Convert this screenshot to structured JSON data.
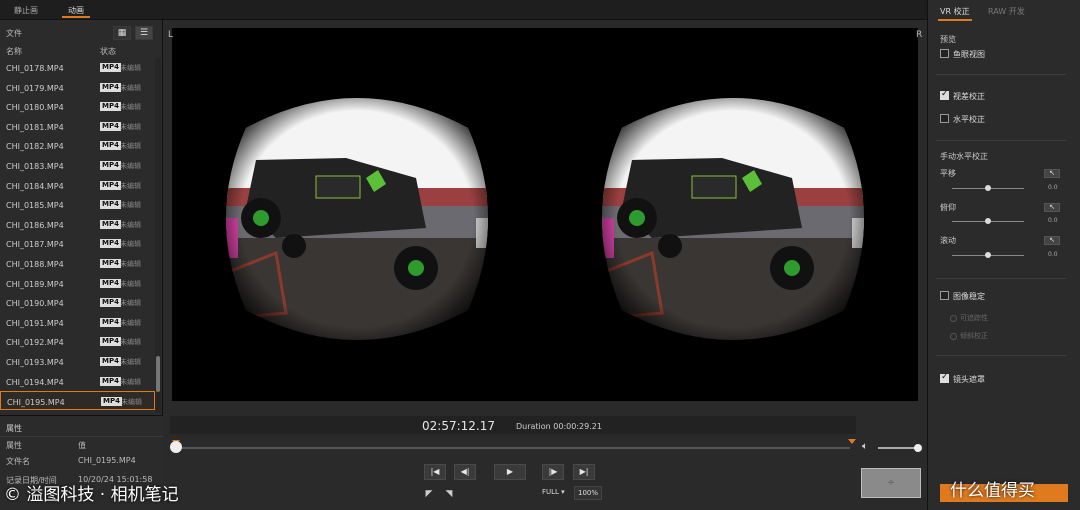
{
  "top_tabs": [
    "静止画",
    "动画"
  ],
  "left": {
    "files_label": "文件",
    "columns": {
      "name": "名称",
      "status": "状态"
    },
    "files": [
      {
        "name": "CHI_0178.MP4",
        "badge": "MP4",
        "status": "未编辑"
      },
      {
        "name": "CHI_0179.MP4",
        "badge": "MP4",
        "status": "未编辑"
      },
      {
        "name": "CHI_0180.MP4",
        "badge": "MP4",
        "status": "未编辑"
      },
      {
        "name": "CHI_0181.MP4",
        "badge": "MP4",
        "status": "未编辑"
      },
      {
        "name": "CHI_0182.MP4",
        "badge": "MP4",
        "status": "未编辑"
      },
      {
        "name": "CHI_0183.MP4",
        "badge": "MP4",
        "status": "未编辑"
      },
      {
        "name": "CHI_0184.MP4",
        "badge": "MP4",
        "status": "未编辑"
      },
      {
        "name": "CHI_0185.MP4",
        "badge": "MP4",
        "status": "未编辑"
      },
      {
        "name": "CHI_0186.MP4",
        "badge": "MP4",
        "status": "未编辑"
      },
      {
        "name": "CHI_0187.MP4",
        "badge": "MP4",
        "status": "未编辑"
      },
      {
        "name": "CHI_0188.MP4",
        "badge": "MP4",
        "status": "未编辑"
      },
      {
        "name": "CHI_0189.MP4",
        "badge": "MP4",
        "status": "未编辑"
      },
      {
        "name": "CHI_0190.MP4",
        "badge": "MP4",
        "status": "未编辑"
      },
      {
        "name": "CHI_0191.MP4",
        "badge": "MP4",
        "status": "未编辑"
      },
      {
        "name": "CHI_0192.MP4",
        "badge": "MP4",
        "status": "未编辑"
      },
      {
        "name": "CHI_0193.MP4",
        "badge": "MP4",
        "status": "未编辑"
      },
      {
        "name": "CHI_0194.MP4",
        "badge": "MP4",
        "status": "未编辑"
      },
      {
        "name": "CHI_0195.MP4",
        "badge": "MP4",
        "status": "未编辑"
      }
    ],
    "selected_index": 17,
    "properties": {
      "title": "属性",
      "header": {
        "key": "属性",
        "value": "值"
      },
      "rows": [
        {
          "key": "文件名",
          "value": "CHI_0195.MP4"
        },
        {
          "key": "记录日期/时间",
          "value": "10/20/24 15:01:58"
        }
      ]
    }
  },
  "viewer": {
    "left_label": "L",
    "right_label": "R",
    "timecode": "02:57:12.17",
    "duration": "Duration 00:00:29.21",
    "controls": {
      "first": "|◀",
      "prev_frame": "◀|",
      "play": "▶",
      "next_frame": "|▶",
      "last": "▶|"
    },
    "full_label": "FULL ▾",
    "zoom_label": "100%",
    "grey_button_label": "÷"
  },
  "right": {
    "tabs": [
      "VR 校正",
      "RAW 开发"
    ],
    "preview_label": "预览",
    "fisheye_view": "鱼眼视图",
    "parallax": "视差校正",
    "horizontal": "水平校正",
    "manual_level": "手动水平校正",
    "sliders": [
      {
        "label": "平移",
        "value": "0.0",
        "reset": "↖"
      },
      {
        "label": "俯仰",
        "value": "0.0",
        "reset": "↖"
      },
      {
        "label": "滚动",
        "value": "0.0",
        "reset": "↖"
      }
    ],
    "stabilize": "图像稳定",
    "radio1": "可追踪性",
    "radio2": "倾斜校正",
    "lens_mask": "镜头遮罩"
  },
  "watermark": "© 溢图科技 · 相机笔记",
  "watermark_right": "什么值得买",
  "colors": {
    "accent": "#e07a1f",
    "panel": "#2b2b2b",
    "viewer_bg": "#000000"
  }
}
